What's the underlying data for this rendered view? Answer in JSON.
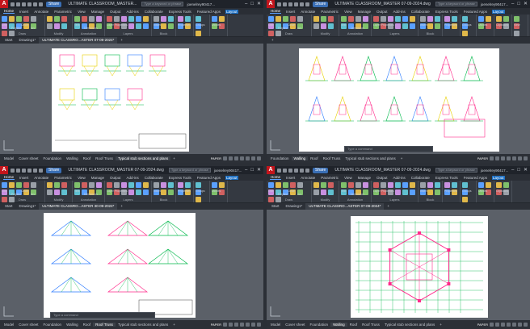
{
  "colors": {
    "accent": "#1b6ec2",
    "brand": "#c4151c"
  },
  "windows": [
    {
      "app_logo": "A",
      "share": "Share",
      "title": "ULTIMATE CLASSROOM_MASTER...",
      "search_placeholder": "Type a keyword or phrase",
      "user": "joenelrey90417...",
      "menu": [
        "Home",
        "Insert",
        "Annotate",
        "Parametric",
        "View",
        "Manage",
        "Output",
        "Add-ins",
        "Collaborate",
        "Express Tools",
        "Featured Apps",
        "Layout"
      ],
      "active_menu": "Layout",
      "panels": [
        {
          "title": "Draw",
          "labels": [
            "Line",
            "Polyline",
            "Circle",
            "Arc"
          ]
        },
        {
          "title": "Modify",
          "labels": []
        },
        {
          "title": "Annotation",
          "labels": [
            "Text",
            "Dimension"
          ]
        },
        {
          "title": "Layers",
          "labels": [
            "Layer Properties"
          ]
        },
        {
          "title": "Block",
          "labels": [
            "Insert"
          ]
        },
        {
          "title": "",
          "labels": [
            "Properties"
          ]
        },
        {
          "title": "",
          "labels": [
            "Groups"
          ]
        },
        {
          "title": "",
          "labels": [
            "Utilities"
          ]
        }
      ],
      "tabs": [
        "Start",
        "Drawing1*",
        "ULTIMATE CLASSRO...ASTER 07-09-2024*"
      ],
      "current_tab": 2,
      "layouts": [
        "Model",
        "Cover sheet",
        "Foundation",
        "Walling",
        "Roof",
        "Roof Truss",
        "Typical stub sections and plans"
      ],
      "active_layout": 6,
      "status": "PAPER",
      "command": "",
      "sheet": "foundation"
    },
    {
      "app_logo": "A",
      "share": "Share",
      "title": "ULTIMATE CLASSROOM_MASTER 07-09-2024.dwg",
      "search_placeholder": "Type a keyword or phrase",
      "user": "joenelrey90417...",
      "menu": [
        "Home",
        "Insert",
        "Annotate",
        "Parametric",
        "View",
        "Manage",
        "Output",
        "Add-ins",
        "Collaborate",
        "Express Tools",
        "Featured Apps",
        "Layout"
      ],
      "active_menu": "Layout",
      "panels": [
        {
          "title": "Draw",
          "labels": [
            "Line",
            "Polyline",
            "Circle",
            "Arc"
          ]
        },
        {
          "title": "Modify",
          "labels": []
        },
        {
          "title": "Annotation",
          "labels": [
            "Text",
            "Dimension"
          ]
        },
        {
          "title": "Layers",
          "labels": [
            "Layer Properties"
          ]
        },
        {
          "title": "Block",
          "labels": [
            "Insert"
          ]
        },
        {
          "title": "",
          "labels": [
            "Properties"
          ]
        },
        {
          "title": "",
          "labels": [
            "Groups"
          ]
        },
        {
          "title": "",
          "labels": [
            "Utilities"
          ]
        },
        {
          "title": "",
          "labels": [
            "Clipboard"
          ]
        },
        {
          "title": "",
          "labels": [
            "View"
          ]
        }
      ],
      "tabs": [],
      "current_tab": -1,
      "layouts": [
        "Foundation",
        "Walling",
        "Roof",
        "Roof Truss",
        "Typical stub sections and plans"
      ],
      "active_layout": 1,
      "status": "PAPER",
      "command": "Type a command",
      "sheet": "walling"
    },
    {
      "app_logo": "A",
      "share": "Share",
      "title": "ULTIMATE CLASSROOM_MASTER 07-09-2024.dwg",
      "search_placeholder": "Type a keyword or phrase",
      "user": "joenelrey90417...",
      "menu": [
        "Home",
        "Insert",
        "Annotate",
        "Parametric",
        "View",
        "Manage",
        "Output",
        "Add-ins",
        "Collaborate",
        "Express Tools",
        "Featured Apps",
        "Layout"
      ],
      "active_menu": "Layout",
      "panels": [
        {
          "title": "Draw",
          "labels": [
            "Line",
            "Polyline",
            "Circle",
            "Arc"
          ]
        },
        {
          "title": "Modify",
          "labels": []
        },
        {
          "title": "Annotation",
          "labels": [
            "Text",
            "Dimension"
          ]
        },
        {
          "title": "Layers",
          "labels": [
            "Layer Properties"
          ]
        },
        {
          "title": "Block",
          "labels": [
            "Insert"
          ]
        },
        {
          "title": "",
          "labels": [
            "Properties"
          ]
        },
        {
          "title": "",
          "labels": [
            "Groups"
          ]
        },
        {
          "title": "",
          "labels": [
            "Utilities"
          ]
        }
      ],
      "tabs": [
        "Start",
        "Drawing1*",
        "ULTIMATE CLASSRO...ASTER 30-09-2024*"
      ],
      "current_tab": 2,
      "layouts": [
        "Model",
        "Cover sheet",
        "Foundation",
        "Walling",
        "Roof",
        "Roof Truss",
        "Typical stub sections and plans"
      ],
      "active_layout": 5,
      "status": "PAPER",
      "command": "Type a command",
      "sheet": "truss"
    },
    {
      "app_logo": "A",
      "share": "Share",
      "title": "ULTIMATE CLASSROOM_MASTER 07-09-2024.dwg",
      "search_placeholder": "Type a keyword or phrase",
      "user": "joenelrey90417...",
      "menu": [
        "Home",
        "Insert",
        "Annotate",
        "Parametric",
        "View",
        "Manage",
        "Output",
        "Add-ins",
        "Collaborate",
        "Express Tools",
        "Featured Apps",
        "Layout"
      ],
      "active_menu": "Layout",
      "panels": [
        {
          "title": "Draw",
          "labels": [
            "Line",
            "Polyline",
            "Circle",
            "Arc"
          ]
        },
        {
          "title": "Modify",
          "labels": []
        },
        {
          "title": "Annotation",
          "labels": [
            "Text",
            "Dimension"
          ]
        },
        {
          "title": "Layers",
          "labels": [
            "Layer Properties"
          ]
        },
        {
          "title": "Block",
          "labels": [
            "Insert"
          ]
        },
        {
          "title": "",
          "labels": [
            "Properties"
          ]
        },
        {
          "title": "",
          "labels": [
            "Groups"
          ]
        },
        {
          "title": "",
          "labels": [
            "Utilities"
          ]
        },
        {
          "title": "",
          "labels": [
            "Clipboard"
          ]
        }
      ],
      "tabs": [
        "Start",
        "Drawing1*",
        "ULTIMATE CLASSRO...ASTER 07-09-2024*"
      ],
      "current_tab": 2,
      "layouts": [
        "Model",
        "Cover sheet",
        "Foundation",
        "Walling",
        "Roof",
        "Roof Truss",
        "Typical stub sections and plans"
      ],
      "active_layout": 3,
      "status": "PAPER",
      "command": "",
      "sheet": "plan"
    }
  ]
}
